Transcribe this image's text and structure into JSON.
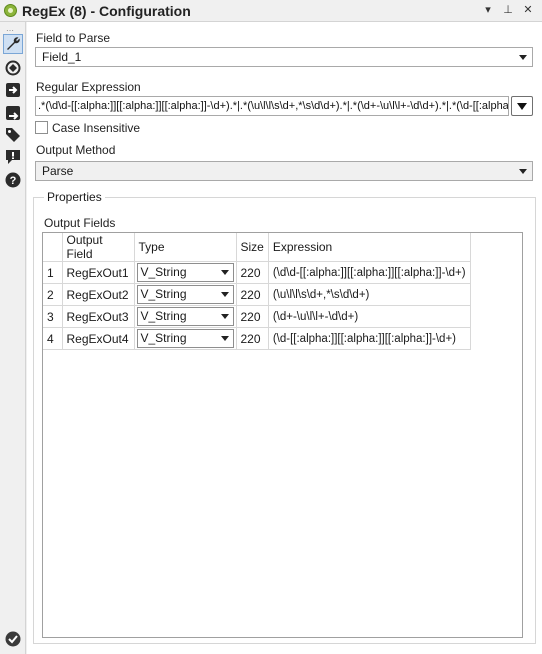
{
  "titlebar": {
    "title": "RegEx (8) - Configuration",
    "dropdown_glyph": "▾",
    "pin_glyph": "⊥",
    "close_glyph": "✕"
  },
  "rail": {
    "icons": [
      "configuration-wrench-icon",
      "connection-icon",
      "input-arrow-icon",
      "output-arrow-icon",
      "tag-icon",
      "error-icon",
      "help-icon"
    ],
    "status_icon": "check-ok-icon"
  },
  "field_to_parse": {
    "label": "Field to Parse",
    "value": "Field_1"
  },
  "regular_expression": {
    "label": "Regular Expression",
    "value": ".*(\\d\\d-[[:alpha:]][[:alpha:]][[:alpha:]]-\\d+).*|.*(\\u\\l\\l\\s\\d+,*\\s\\d\\d+).*|.*(\\d+-\\u\\l\\l+-\\d\\d+).*|.*(\\d-[[:alpha:]][[:alpha:]][[:alpha:]]-\\d+).*"
  },
  "case_insensitive": {
    "label": "Case Insensitive",
    "checked": false
  },
  "output_method": {
    "label": "Output Method",
    "value": "Parse"
  },
  "properties": {
    "label": "Properties",
    "output_fields_label": "Output Fields",
    "columns": [
      "",
      "Output Field",
      "Type",
      "Size",
      "Expression"
    ],
    "rows": [
      {
        "idx": "1",
        "field": "RegExOut1",
        "type": "V_String",
        "size": "220",
        "expr": "(\\d\\d-[[:alpha:]][[:alpha:]][[:alpha:]]-\\d+)"
      },
      {
        "idx": "2",
        "field": "RegExOut2",
        "type": "V_String",
        "size": "220",
        "expr": "(\\u\\l\\l\\s\\d+,*\\s\\d\\d+)"
      },
      {
        "idx": "3",
        "field": "RegExOut3",
        "type": "V_String",
        "size": "220",
        "expr": "(\\d+-\\u\\l\\l+-\\d\\d+)"
      },
      {
        "idx": "4",
        "field": "RegExOut4",
        "type": "V_String",
        "size": "220",
        "expr": "(\\d-[[:alpha:]][[:alpha:]][[:alpha:]]-\\d+)"
      }
    ]
  },
  "colors": {
    "panel_bg": "#ffffff",
    "chrome_bg": "#f0f0f0",
    "app_icon_green": "#8cb43a",
    "rail_icon_dark": "#2b2b2b",
    "ok_icon_green": "#3a3a3a"
  }
}
